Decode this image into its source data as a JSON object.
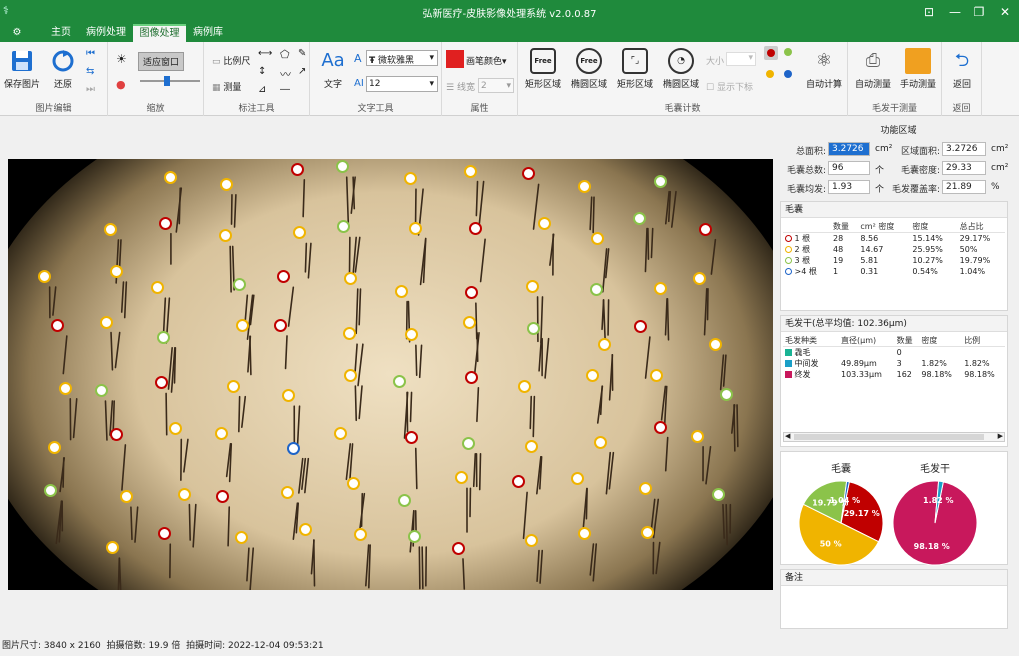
{
  "window": {
    "title": "弘新医疗-皮肤影像处理系统 v2.0.0.87"
  },
  "menu": {
    "tabs": [
      "主页",
      "病例处理",
      "图像处理",
      "病例库"
    ]
  },
  "ribbon": {
    "save": "保存图片",
    "restore": "还原",
    "fit": "适应窗口",
    "ruler": "比例尺",
    "measure": "测量",
    "text": "文字",
    "font": "微软雅黑",
    "fontsize": "12",
    "pen_color": "画笔颜色",
    "line_width": "线宽",
    "line_width_value": "2",
    "free_rect": "矩形区域",
    "free_ellipse": "椭圆区域",
    "rect_area": "矩形区域",
    "ellipse_area": "椭圆区域",
    "size": "大小",
    "show_index": "显示下标",
    "auto_calc": "自动计算",
    "auto_measure": "自动测量",
    "manual_measure": "手动测量",
    "back": "返回",
    "free": "Free",
    "font_icon": "Aa",
    "font_icon2": "A",
    "font_icon3": "AI",
    "pen_red": "#e02020",
    "groups": [
      "图片编辑",
      "缩放",
      "标注工具",
      "文字工具",
      "属性",
      "毛囊计数",
      "毛发干测量",
      "返回"
    ]
  },
  "panel": {
    "title": "功能区域",
    "total_area_label": "总面积:",
    "total_area": "3.2726",
    "area_unit": "cm²",
    "region_area_label": "区域面积:",
    "region_area": "3.2726",
    "region_unit": "cm²",
    "follicle_total_label": "毛囊总数:",
    "follicle_total": "96",
    "count_unit": "个",
    "follicle_density_label": "毛囊密度:",
    "follicle_density": "29.33",
    "density_unit": "cm²",
    "avg_hair_label": "毛囊均发:",
    "avg_hair": "1.93",
    "avg_unit": "个",
    "coverage_label": "毛发覆盖率:",
    "coverage": "21.89",
    "coverage_unit": "%"
  },
  "follicle": {
    "title": "毛囊",
    "headers": [
      "",
      "数量",
      "cm² 密度",
      "密度",
      "总占比"
    ],
    "rows": [
      {
        "label": "1 根",
        "count": "28",
        "cm": "8.56",
        "density": "15.14%",
        "ratio": "29.17%",
        "color": "#c00000"
      },
      {
        "label": "2 根",
        "count": "48",
        "cm": "14.67",
        "density": "25.95%",
        "ratio": "50%",
        "color": "#f0b400"
      },
      {
        "label": "3 根",
        "count": "19",
        "cm": "5.81",
        "density": "10.27%",
        "ratio": "19.79%",
        "color": "#8bc34a"
      },
      {
        "label": ">4 根",
        "count": "1",
        "cm": "0.31",
        "density": "0.54%",
        "ratio": "1.04%",
        "color": "#1e64c8"
      }
    ]
  },
  "shaft": {
    "title": "毛发干(总平均值: 102.36μm)",
    "headers": [
      "毛发种类",
      "直径(μm)",
      "数量",
      "密度",
      "比例"
    ],
    "rows": [
      {
        "label": "毳毛",
        "diam": "",
        "count": "0",
        "density": "",
        "ratio": "",
        "color": "#1ab394"
      },
      {
        "label": "中间发",
        "diam": "49.89μm",
        "count": "3",
        "density": "1.82%",
        "ratio": "1.82%",
        "color": "#1a9fc7"
      },
      {
        "label": "终发",
        "diam": "103.33μm",
        "count": "162",
        "density": "98.18%",
        "ratio": "98.18%",
        "color": "#c8185c"
      }
    ]
  },
  "charts": {
    "follicle_title": "毛囊",
    "shaft_title": "毛发干",
    "follicle_pie": {
      "values": [
        29.17,
        50,
        19.79,
        1.04
      ],
      "labels": [
        "29.17 %",
        "50 %",
        "19.79 %",
        "1.04 %"
      ],
      "colors": [
        "#c00000",
        "#f0b400",
        "#8bc34a",
        "#1e64c8"
      ]
    },
    "shaft_pie": {
      "values": [
        98.18,
        1.82
      ],
      "labels": [
        "98.18 %",
        "1.82 %"
      ],
      "colors": [
        "#c8185c",
        "#1a9fc7"
      ]
    }
  },
  "notes": {
    "title": "备注"
  },
  "status": {
    "image_size_label": "图片尺寸:",
    "image_size": "3840 x 2160",
    "mag_label": "拍摄倍数:",
    "mag": "19.9 倍",
    "time_label": "拍摄时间:",
    "time": "2022-12-04 09:53:21"
  }
}
